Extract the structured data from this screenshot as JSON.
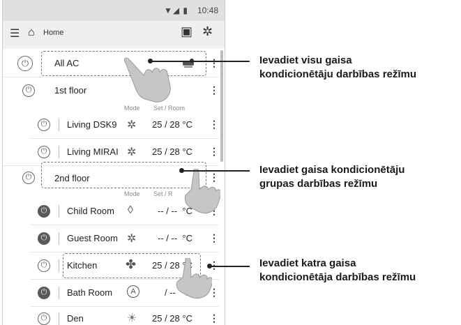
{
  "status_bar": {
    "time": "10:48",
    "icons": "wifi-signal-battery"
  },
  "app_bar": {
    "title": "Home",
    "menu_icon": "hamburger-icon",
    "home_icon": "home-icon",
    "schedule_icon": "schedule-icon",
    "settings_icon": "gear-icon"
  },
  "all_ac": {
    "label": "All AC"
  },
  "floor1": {
    "label": "1st floor",
    "header_mode": "Mode",
    "header_set_room": "Set / Room",
    "units": [
      {
        "label": "Living DSK9",
        "mode_icon": "heat-icon",
        "temp": "25 / 28",
        "unit": "°C",
        "power": "on"
      },
      {
        "label": "Living MIRAI",
        "mode_icon": "heat-icon",
        "temp": "25 / 28",
        "unit": "°C",
        "power": "on"
      }
    ]
  },
  "floor2": {
    "label": "2nd floor",
    "header_mode": "Mode",
    "header_set_room": "Set / R",
    "units": [
      {
        "label": "Child Room",
        "mode_icon": "dry-icon",
        "temp": "-- / --",
        "unit": "°C",
        "power": "off"
      },
      {
        "label": "Guest Room",
        "mode_icon": "heat-icon",
        "temp": "-- / --",
        "unit": "°C",
        "power": "off"
      },
      {
        "label": "Kitchen",
        "mode_icon": "fan-icon",
        "temp": "25 / 28",
        "unit": "°C",
        "power": "on"
      },
      {
        "label": "Bath Room",
        "mode_icon": "auto-icon",
        "temp": "/ --",
        "unit": "°C",
        "power": "off"
      },
      {
        "label": "Den",
        "mode_icon": "cool-icon",
        "temp": "25 / 28",
        "unit": "°C",
        "power": "on"
      }
    ]
  },
  "callouts": [
    {
      "line1": "Ievadiet visu gaisa",
      "line2": "kondicionētāju darbības režīmu"
    },
    {
      "line1": "Ievadiet gaisa kondicionētāju",
      "line2": "grupas darbības režīmu"
    },
    {
      "line1": "Ievadiet katra gaisa",
      "line2": "kondicionētāja darbības režīmu"
    }
  ]
}
